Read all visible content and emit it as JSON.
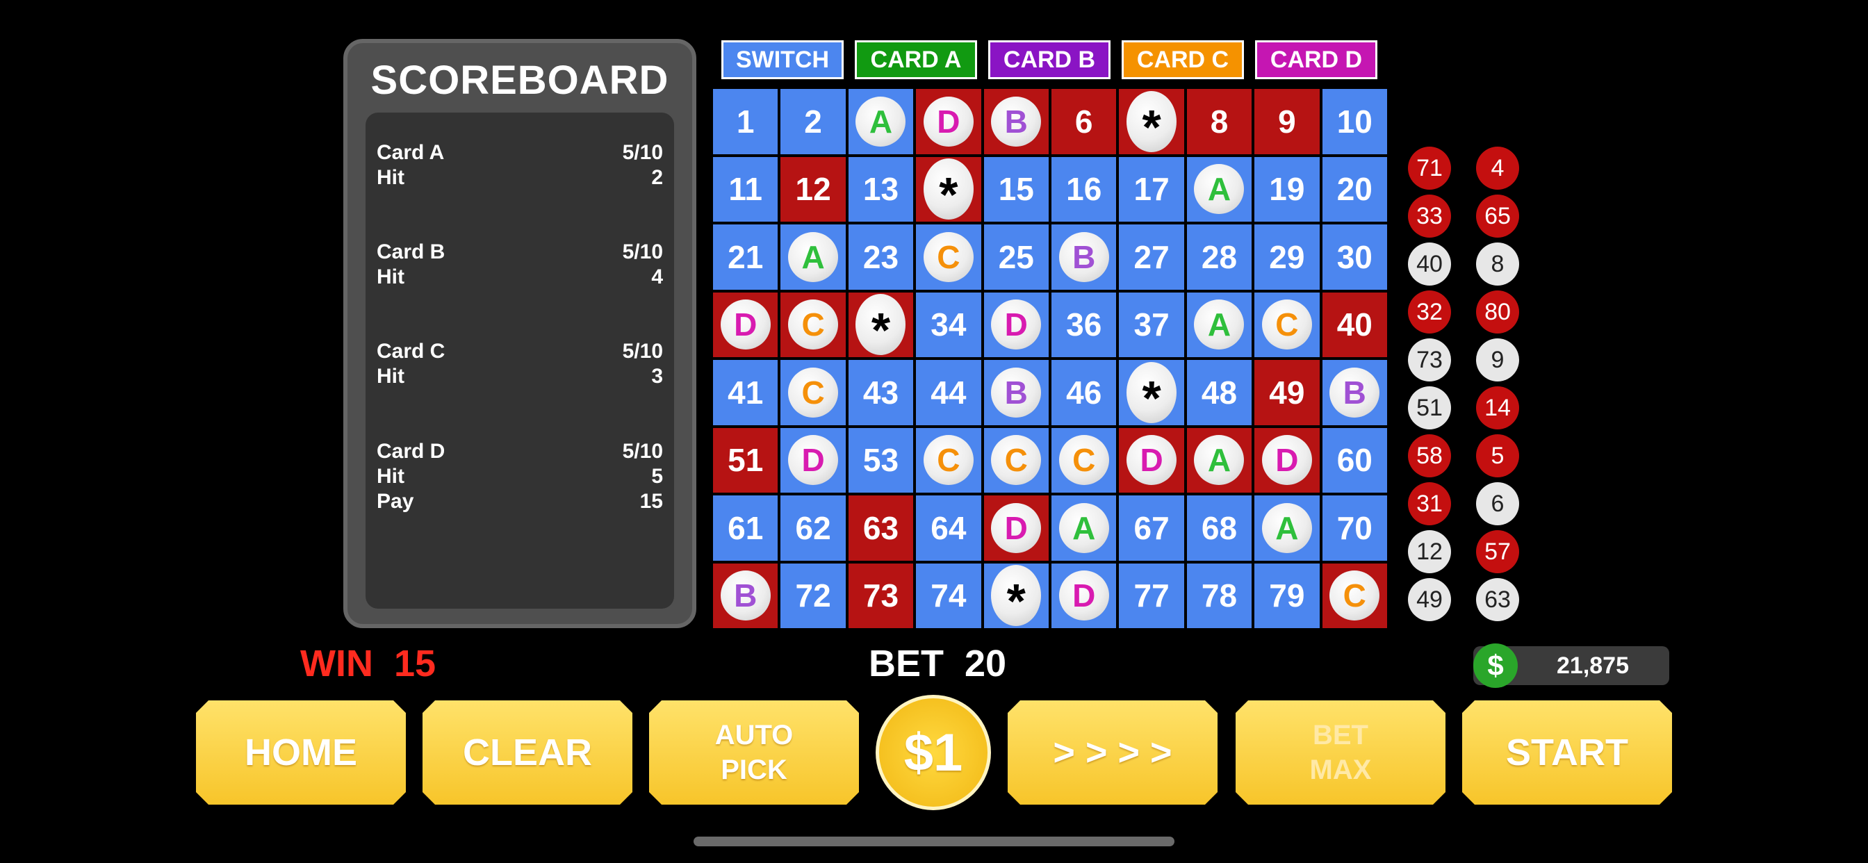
{
  "scoreboard": {
    "title": "SCOREBOARD",
    "card_a": {
      "name": "Card A",
      "score": "5/10",
      "hit_label": "Hit",
      "hit": "2"
    },
    "card_b": {
      "name": "Card B",
      "score": "5/10",
      "hit_label": "Hit",
      "hit": "4"
    },
    "card_c": {
      "name": "Card C",
      "score": "5/10",
      "hit_label": "Hit",
      "hit": "3"
    },
    "card_d": {
      "name": "Card D",
      "score": "5/10",
      "hit_label": "Hit",
      "hit": "5",
      "pay_label": "Pay",
      "pay": "15"
    }
  },
  "tabs": {
    "switch": "SWITCH",
    "card_a": "CARD A",
    "card_b": "CARD B",
    "card_c": "CARD C",
    "card_d": "CARD D"
  },
  "colors": {
    "switch": "#4c86ef",
    "card_a": "#119a11",
    "card_b": "#8a14c4",
    "card_c": "#f59200",
    "card_d": "#c516b2",
    "cell_blue": "#4c86ef",
    "cell_red": "#b61313"
  },
  "grid": [
    [
      {
        "t": "1"
      },
      {
        "t": "2"
      },
      {
        "m": "A"
      },
      {
        "m": "D",
        "hit": true
      },
      {
        "m": "B",
        "hit": true
      },
      {
        "t": "6",
        "hit": true
      },
      {
        "m": "*",
        "hit": true
      },
      {
        "t": "8",
        "hit": true
      },
      {
        "t": "9",
        "hit": true
      },
      {
        "t": "10"
      }
    ],
    [
      {
        "t": "11"
      },
      {
        "t": "12",
        "hit": true
      },
      {
        "t": "13"
      },
      {
        "m": "*",
        "hit": true
      },
      {
        "t": "15"
      },
      {
        "t": "16"
      },
      {
        "t": "17"
      },
      {
        "m": "A"
      },
      {
        "t": "19"
      },
      {
        "t": "20"
      }
    ],
    [
      {
        "t": "21"
      },
      {
        "m": "A"
      },
      {
        "t": "23"
      },
      {
        "m": "C"
      },
      {
        "t": "25"
      },
      {
        "m": "B"
      },
      {
        "t": "27"
      },
      {
        "t": "28"
      },
      {
        "t": "29"
      },
      {
        "t": "30"
      }
    ],
    [
      {
        "m": "D",
        "hit": true
      },
      {
        "m": "C",
        "hit": true
      },
      {
        "m": "*",
        "hit": true
      },
      {
        "t": "34"
      },
      {
        "m": "D"
      },
      {
        "t": "36"
      },
      {
        "t": "37"
      },
      {
        "m": "A"
      },
      {
        "m": "C"
      },
      {
        "t": "40",
        "hit": true
      }
    ],
    [
      {
        "t": "41"
      },
      {
        "m": "C"
      },
      {
        "t": "43"
      },
      {
        "t": "44"
      },
      {
        "m": "B"
      },
      {
        "t": "46"
      },
      {
        "m": "*"
      },
      {
        "t": "48"
      },
      {
        "t": "49",
        "hit": true
      },
      {
        "m": "B"
      }
    ],
    [
      {
        "t": "51",
        "hit": true
      },
      {
        "m": "D"
      },
      {
        "t": "53"
      },
      {
        "m": "C"
      },
      {
        "m": "C"
      },
      {
        "m": "C"
      },
      {
        "m": "D",
        "hit": true
      },
      {
        "m": "A",
        "hit": true
      },
      {
        "m": "D",
        "hit": true
      },
      {
        "t": "60"
      }
    ],
    [
      {
        "t": "61"
      },
      {
        "t": "62"
      },
      {
        "t": "63",
        "hit": true
      },
      {
        "t": "64"
      },
      {
        "m": "D",
        "hit": true
      },
      {
        "m": "A"
      },
      {
        "t": "67"
      },
      {
        "t": "68"
      },
      {
        "m": "A"
      },
      {
        "t": "70"
      }
    ],
    [
      {
        "m": "B",
        "hit": true
      },
      {
        "t": "72"
      },
      {
        "t": "73",
        "hit": true
      },
      {
        "t": "74"
      },
      {
        "m": "*"
      },
      {
        "m": "D"
      },
      {
        "t": "77"
      },
      {
        "t": "78"
      },
      {
        "t": "79"
      },
      {
        "m": "C",
        "hit": true
      }
    ]
  ],
  "drawn_balls": {
    "col1": [
      {
        "n": "71",
        "c": "red"
      },
      {
        "n": "33",
        "c": "red"
      },
      {
        "n": "40",
        "c": "white"
      },
      {
        "n": "32",
        "c": "red"
      },
      {
        "n": "73",
        "c": "white"
      },
      {
        "n": "51",
        "c": "white"
      },
      {
        "n": "58",
        "c": "red"
      },
      {
        "n": "31",
        "c": "red"
      },
      {
        "n": "12",
        "c": "white"
      },
      {
        "n": "49",
        "c": "white"
      }
    ],
    "col2": [
      {
        "n": "4",
        "c": "red"
      },
      {
        "n": "65",
        "c": "red"
      },
      {
        "n": "8",
        "c": "white"
      },
      {
        "n": "80",
        "c": "red"
      },
      {
        "n": "9",
        "c": "white"
      },
      {
        "n": "14",
        "c": "red"
      },
      {
        "n": "5",
        "c": "red"
      },
      {
        "n": "6",
        "c": "white"
      },
      {
        "n": "57",
        "c": "red"
      },
      {
        "n": "63",
        "c": "white"
      }
    ]
  },
  "status": {
    "win_label": "WIN",
    "win_value": "15",
    "bet_label": "BET",
    "bet_value": "20",
    "credits": "21,875",
    "credit_icon": "$"
  },
  "buttons": {
    "home": "HOME",
    "clear": "CLEAR",
    "auto_pick": "AUTO\nPICK",
    "coin": "$1",
    "speed": "> > > >",
    "bet_max": "BET\nMAX",
    "start": "START"
  }
}
